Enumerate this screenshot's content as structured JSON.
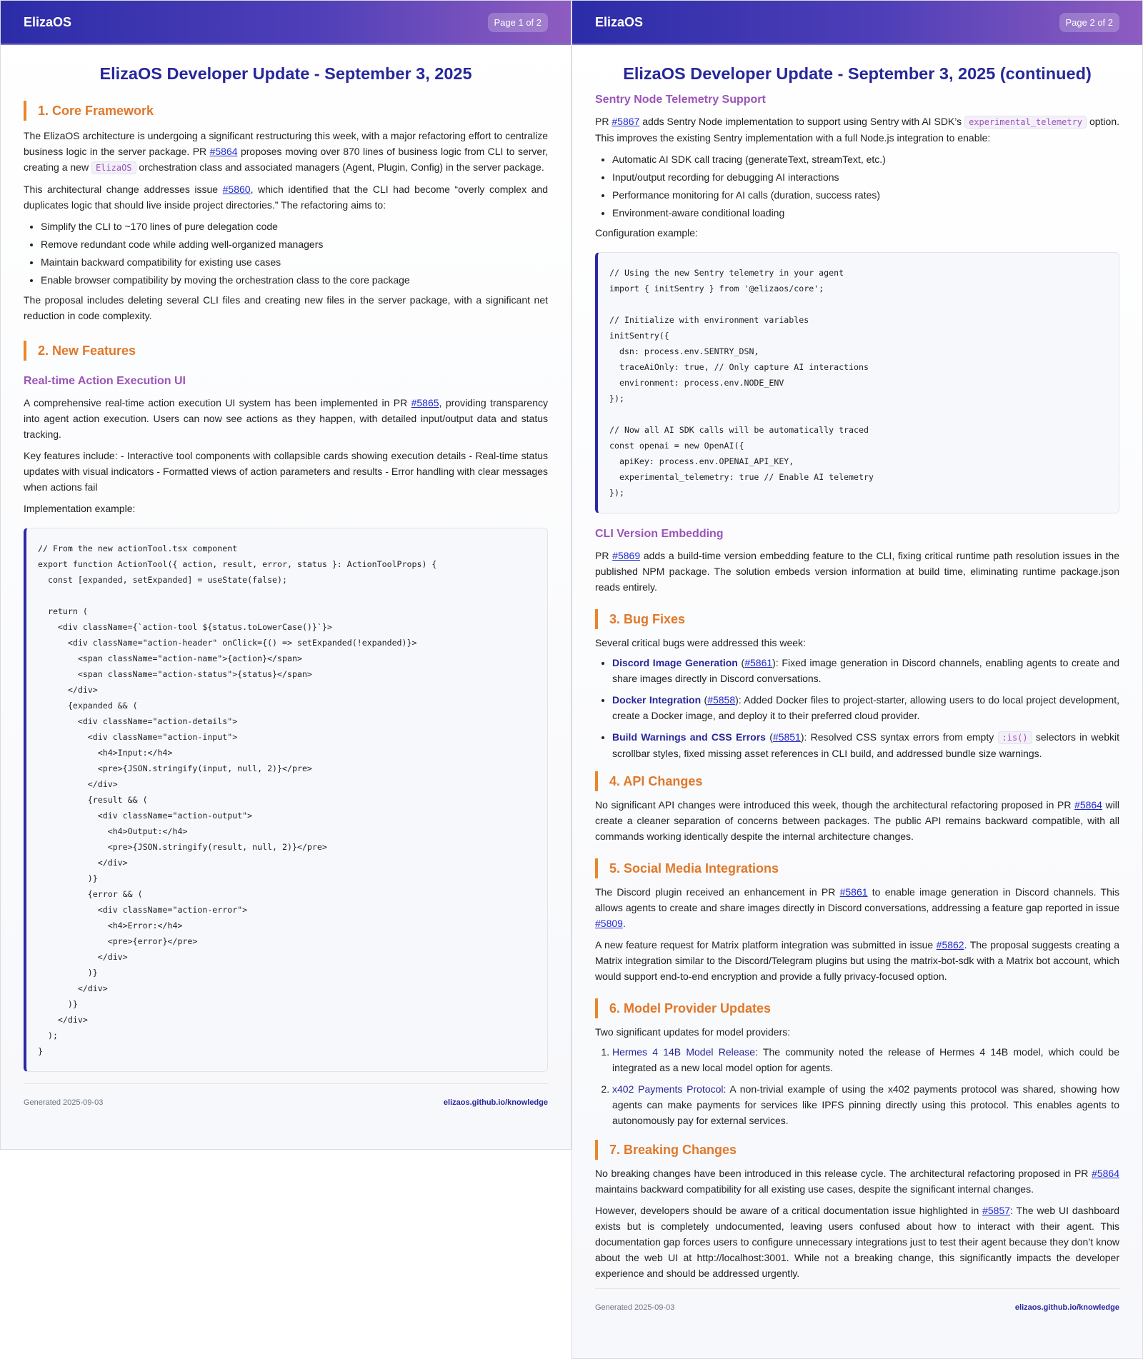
{
  "brand": "ElizaOS",
  "page1": {
    "badge": "Page 1 of 2",
    "title": "ElizaOS Developer Update - September 3, 2025",
    "s1": {
      "heading": "1. Core Framework",
      "p1a": "The ElizaOS architecture is undergoing a significant restructuring this week, with a major refactoring effort to centralize business logic in the server package. PR ",
      "p1link": "#5864",
      "p1b": " proposes moving over 870 lines of business logic from CLI to server, creating a new ",
      "p1code": "ElizaOS",
      "p1c": " orchestration class and associated managers (Agent, Plugin, Config) in the server package.",
      "p2a": "This architectural change addresses issue ",
      "p2link": "#5860",
      "p2b": ", which identified that the CLI had become “overly complex and duplicates logic that should live inside project directories.” The refactoring aims to:",
      "bullets": [
        "Simplify the CLI to ~170 lines of pure delegation code",
        "Remove redundant code while adding well-organized managers",
        "Maintain backward compatibility for existing use cases",
        "Enable browser compatibility by moving the orchestration class to the core package"
      ],
      "p3": "The proposal includes deleting several CLI files and creating new files in the server package, with a significant net reduction in code complexity."
    },
    "s2": {
      "heading": "2. New Features",
      "sub": "Real-time Action Execution UI",
      "p1a": "A comprehensive real-time action execution UI system has been implemented in PR ",
      "p1link": "#5865",
      "p1b": ", providing transparency into agent action execution. Users can now see actions as they happen, with detailed input/output data and status tracking.",
      "p2": "Key features include: - Interactive tool components with collapsible cards showing execution details - Real-time status updates with visual indicators - Formatted views of action parameters and results - Error handling with clear messages when actions fail",
      "p3": "Implementation example:",
      "code": "// From the new actionTool.tsx component\nexport function ActionTool({ action, result, error, status }: ActionToolProps) {\n  const [expanded, setExpanded] = useState(false);\n\n  return (\n    <div className={`action-tool ${status.toLowerCase()}`}>\n      <div className=\"action-header\" onClick={() => setExpanded(!expanded)}>\n        <span className=\"action-name\">{action}</span>\n        <span className=\"action-status\">{status}</span>\n      </div>\n      {expanded && (\n        <div className=\"action-details\">\n          <div className=\"action-input\">\n            <h4>Input:</h4>\n            <pre>{JSON.stringify(input, null, 2)}</pre>\n          </div>\n          {result && (\n            <div className=\"action-output\">\n              <h4>Output:</h4>\n              <pre>{JSON.stringify(result, null, 2)}</pre>\n            </div>\n          )}\n          {error && (\n            <div className=\"action-error\">\n              <h4>Error:</h4>\n              <pre>{error}</pre>\n            </div>\n          )}\n        </div>\n      )}\n    </div>\n  );\n}"
    },
    "footer": {
      "generated": "Generated 2025-09-03",
      "site": "elizaos.github.io/knowledge"
    }
  },
  "page2": {
    "badge": "Page 2 of 2",
    "title": "ElizaOS Developer Update - September 3, 2025 (continued)",
    "sentry": {
      "sub": "Sentry Node Telemetry Support",
      "p1a": "PR ",
      "p1link": "#5867",
      "p1b": " adds Sentry Node implementation to support using Sentry with AI SDK’s ",
      "p1code": "experimental_telemetry",
      "p1c": " option. This improves the existing Sentry implementation with a full Node.js integration to enable:",
      "bullets": [
        "Automatic AI SDK call tracing (generateText, streamText, etc.)",
        "Input/output recording for debugging AI interactions",
        "Performance monitoring for AI calls (duration, success rates)",
        "Environment-aware conditional loading"
      ],
      "p2": "Configuration example:",
      "code": "// Using the new Sentry telemetry in your agent\nimport { initSentry } from '@elizaos/core';\n\n// Initialize with environment variables\ninitSentry({\n  dsn: process.env.SENTRY_DSN,\n  traceAiOnly: true, // Only capture AI interactions\n  environment: process.env.NODE_ENV\n});\n\n// Now all AI SDK calls will be automatically traced\nconst openai = new OpenAI({\n  apiKey: process.env.OPENAI_API_KEY,\n  experimental_telemetry: true // Enable AI telemetry\n});"
    },
    "cli": {
      "sub": "CLI Version Embedding",
      "p1a": "PR ",
      "p1link": "#5869",
      "p1b": " adds a build-time version embedding feature to the CLI, fixing critical runtime path resolution issues in the published NPM package. The solution embeds version information at build time, eliminating runtime package.json reads entirely."
    },
    "s3": {
      "heading": "3. Bug Fixes",
      "intro": "Several critical bugs were addressed this week:",
      "b1title": "Discord Image Generation",
      "b1link": "#5861",
      "b1text": ": Fixed image generation in Discord channels, enabling agents to create and share images directly in Discord conversations.",
      "b2title": "Docker Integration",
      "b2link": "#5858",
      "b2text": ": Added Docker files to project-starter, allowing users to do local project development, create a Docker image, and deploy it to their preferred cloud provider.",
      "b3title": "Build Warnings and CSS Errors",
      "b3link": "#5851",
      "b3texta": ": Resolved CSS syntax errors from empty ",
      "b3code": ":is()",
      "b3textb": " selectors in webkit scrollbar styles, fixed missing asset references in CLI build, and addressed bundle size warnings."
    },
    "s4": {
      "heading": "4. API Changes",
      "p1a": "No significant API changes were introduced this week, though the architectural refactoring proposed in PR ",
      "p1link": "#5864",
      "p1b": " will create a cleaner separation of concerns between packages. The public API remains backward compatible, with all commands working identically despite the internal architecture changes."
    },
    "s5": {
      "heading": "5. Social Media Integrations",
      "p1a": "The Discord plugin received an enhancement in PR ",
      "p1link": "#5861",
      "p1b": " to enable image generation in Discord channels. This allows agents to create and share images directly in Discord conversations, addressing a feature gap reported in issue ",
      "p1link2": "#5809",
      "p1c": ".",
      "p2a": "A new feature request for Matrix platform integration was submitted in issue ",
      "p2link": "#5862",
      "p2b": ". The proposal suggests creating a Matrix integration similar to the Discord/Telegram plugins but using the matrix-bot-sdk with a Matrix bot account, which would support end-to-end encryption and provide a fully privacy-focused option."
    },
    "s6": {
      "heading": "6. Model Provider Updates",
      "intro": "Two significant updates for model providers:",
      "i1title": "Hermes 4 14B Model Release",
      "i1text": ": The community noted the release of Hermes 4 14B model, which could be integrated as a new local model option for agents.",
      "i2title": "x402 Payments Protocol",
      "i2text": ": A non-trivial example of using the x402 payments protocol was shared, showing how agents can make payments for services like IPFS pinning directly using this protocol. This enables agents to autonomously pay for external services."
    },
    "s7": {
      "heading": "7. Breaking Changes",
      "p1a": "No breaking changes have been introduced in this release cycle. The architectural refactoring proposed in PR ",
      "p1link": "#5864",
      "p1b": " maintains backward compatibility for all existing use cases, despite the significant internal changes.",
      "p2a": "However, developers should be aware of a critical documentation issue highlighted in ",
      "p2link": "#5857",
      "p2b": ": The web UI dashboard exists but is completely undocumented, leaving users confused about how to interact with their agent. This documentation gap forces users to configure unnecessary integrations just to test their agent because they don’t know about the web UI at http://localhost:3001. While not a breaking change, this significantly impacts the developer experience and should be addressed urgently."
    },
    "footer": {
      "generated": "Generated 2025-09-03",
      "site": "elizaos.github.io/knowledge"
    }
  }
}
